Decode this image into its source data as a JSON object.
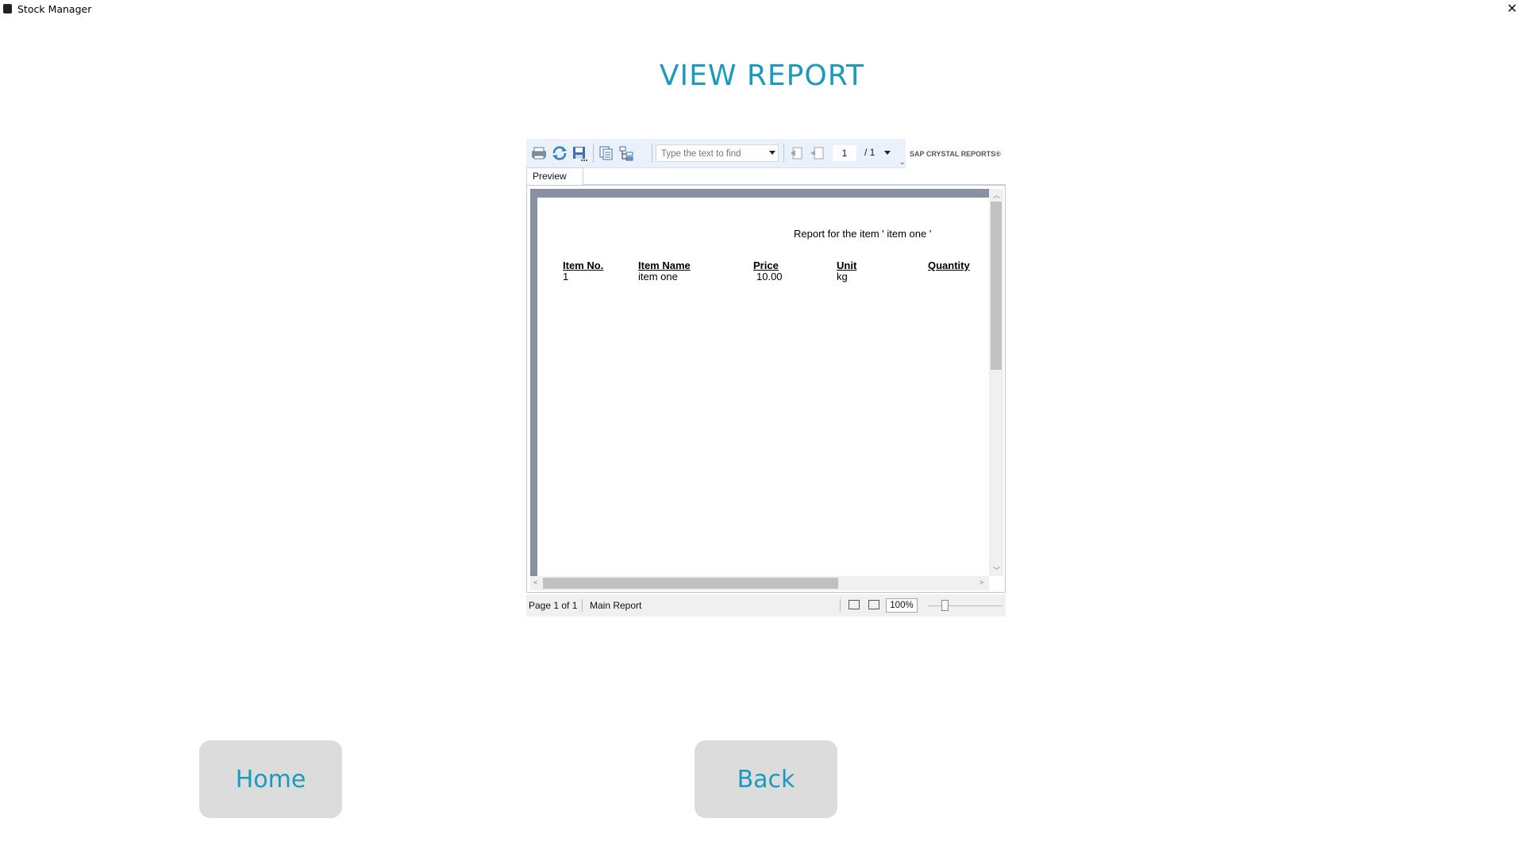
{
  "window": {
    "title": "Stock Manager",
    "close_symbol": "✕"
  },
  "page": {
    "title": "VIEW REPORT"
  },
  "viewer": {
    "toolbar": {
      "icons": [
        "print-icon",
        "refresh-icon",
        "export-icon",
        "copy-icon",
        "group-tree-icon",
        "first-page-icon",
        "previous-page-icon"
      ],
      "find_placeholder": "Type the text to find",
      "current_page": "1",
      "total_pages": "/ 1",
      "brand": "SAP CRYSTAL REPORTS®"
    },
    "tab_label": "Preview",
    "report": {
      "title": "Report for the item ' item one '",
      "columns": [
        "Item No.",
        "Item Name",
        "Price",
        "Unit",
        "Quantity"
      ],
      "rows": [
        [
          "1",
          "item one",
          "10.00",
          "kg",
          ""
        ]
      ]
    },
    "status": {
      "page_info": "Page 1 of 1",
      "report_name": "Main Report",
      "zoom": "100%"
    }
  },
  "buttons": {
    "home": "Home",
    "back": "Back"
  }
}
